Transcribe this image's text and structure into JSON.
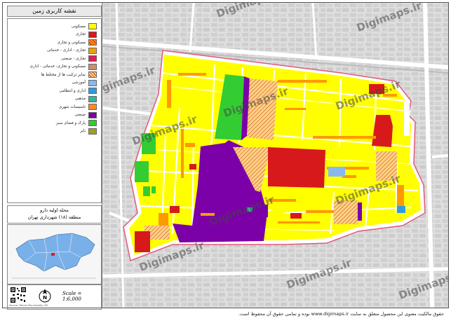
{
  "legend": {
    "title": "نقشه کاربری زمین",
    "items": [
      {
        "label": "مسکونی",
        "color": "#ffff00"
      },
      {
        "label": "تجاری",
        "color": "#d7191c"
      },
      {
        "label": "مسکونی و تجاری",
        "color": "#ff9900",
        "hatch": "#d7191c"
      },
      {
        "label": "تجاری - اداری - خدماتی",
        "color": "#f0a000"
      },
      {
        "label": "تجاری - صنعتی",
        "color": "#e31a5a"
      },
      {
        "label": "مسکونی و تجاری، خدماتی - اداری",
        "color": "#c89070"
      },
      {
        "label": "سایر ترکیب ها از مختلط ها",
        "color": "#ffd27f",
        "hatch": "#c0392b"
      },
      {
        "label": "آموزشی",
        "color": "#89b8f0"
      },
      {
        "label": "اداری و انتظامی",
        "color": "#2b9de0"
      },
      {
        "label": "مذهبی",
        "color": "#2eb8a0"
      },
      {
        "label": "تاسیسات شهری",
        "color": "#ff8c1a"
      },
      {
        "label": "صنعتی",
        "color": "#7b00a8"
      },
      {
        "label": "پارک و فضای سبز",
        "color": "#33cc33"
      },
      {
        "label": "بایر",
        "color": "#9ea020"
      }
    ]
  },
  "info": {
    "line1": "محله اولیه دارو",
    "line2": "منطقه (۱۸) شهرداری تهران"
  },
  "scale": {
    "text": "Scale = 1:6,000"
  },
  "credit": "Source: Tehran Municipality GIS",
  "watermarks": [
    "Digimaps.ir",
    "Digimaps.ir",
    "Digimaps.ir",
    "Digimaps.ir",
    "Digimaps.ir",
    "Digimaps.ir",
    "Digimaps.ir",
    "Digimaps.ir",
    "Digimaps.ir",
    "Digimaps.ir",
    "Digimaps.ir"
  ],
  "footer": "حقوق مالکیت معنوی این محصول متعلق به سایت www.digimaps.ir بوده و تمامی حقوق آن محفوظ است."
}
